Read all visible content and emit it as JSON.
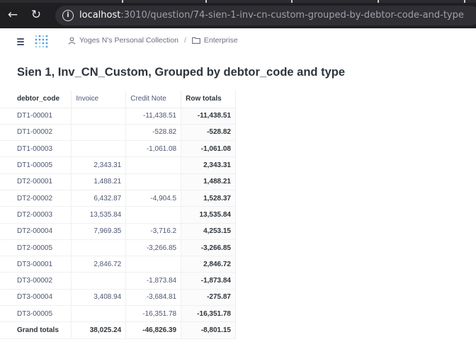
{
  "browser": {
    "url_host": "localhost",
    "url_path": ":3010/question/74-sien-1-inv-cn-custom-grouped-by-debtor-code-and-type",
    "back_icon": "arrow-left-icon",
    "reload_icon": "reload-icon",
    "info_icon": "info-icon"
  },
  "header": {
    "menu_icon": "hamburger-icon",
    "logo": "metabase-logo",
    "breadcrumb": {
      "collection": "Yoges N's Personal Collection",
      "separator": "/",
      "folder": "Enterprise"
    }
  },
  "question": {
    "title": "Sien 1, Inv_CN_Custom, Grouped by debtor_code and type"
  },
  "table": {
    "columns": [
      "debtor_code",
      "Invoice",
      "Credit Note",
      "Row totals"
    ],
    "rows": [
      [
        "DT1-00001",
        "",
        "-11,438.51",
        "-11,438.51"
      ],
      [
        "DT1-00002",
        "",
        "-528.82",
        "-528.82"
      ],
      [
        "DT1-00003",
        "",
        "-1,061.08",
        "-1,061.08"
      ],
      [
        "DT1-00005",
        "2,343.31",
        "",
        "2,343.31"
      ],
      [
        "DT2-00001",
        "1,488.21",
        "",
        "1,488.21"
      ],
      [
        "DT2-00002",
        "6,432.87",
        "-4,904.5",
        "1,528.37"
      ],
      [
        "DT2-00003",
        "13,535.84",
        "",
        "13,535.84"
      ],
      [
        "DT2-00004",
        "7,969.35",
        "-3,716.2",
        "4,253.15"
      ],
      [
        "DT2-00005",
        "",
        "-3,266.85",
        "-3,266.85"
      ],
      [
        "DT3-00001",
        "2,846.72",
        "",
        "2,846.72"
      ],
      [
        "DT3-00002",
        "",
        "-1,873.84",
        "-1,873.84"
      ],
      [
        "DT3-00004",
        "3,408.94",
        "-3,684.81",
        "-275.87"
      ],
      [
        "DT3-00005",
        "",
        "-16,351.78",
        "-16,351.78"
      ]
    ],
    "grand_totals": [
      "Grand totals",
      "38,025.24",
      "-46,826.39",
      "-8,801.15"
    ]
  }
}
